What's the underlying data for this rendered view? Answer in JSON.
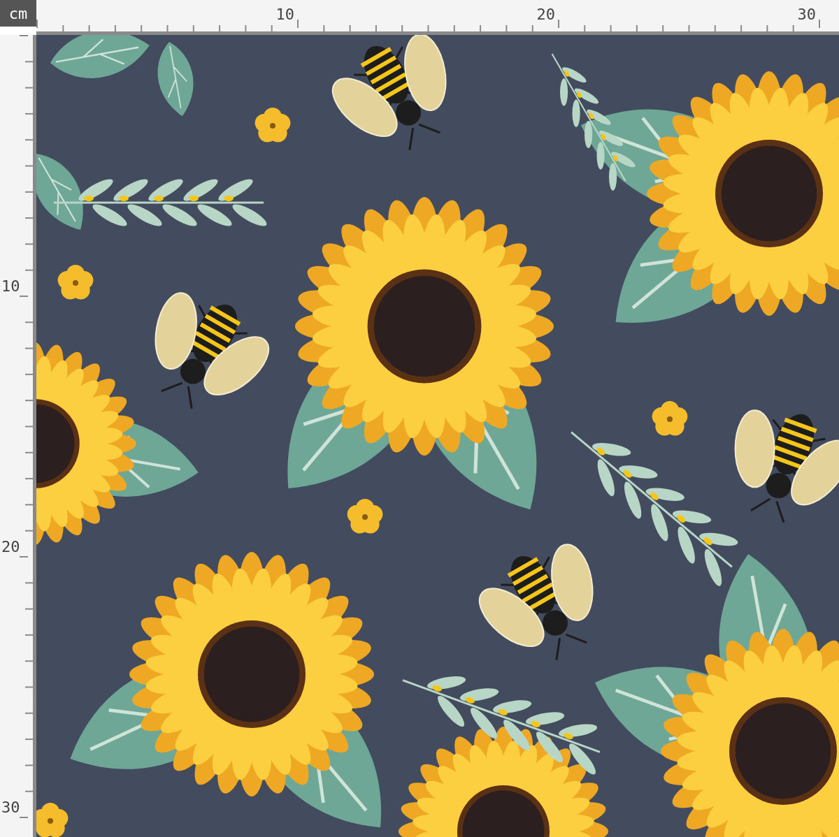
{
  "ruler": {
    "unit": "cm",
    "top_labels": [
      "10",
      "20",
      "30"
    ],
    "left_labels": [
      "10",
      "20",
      "30"
    ]
  }
}
